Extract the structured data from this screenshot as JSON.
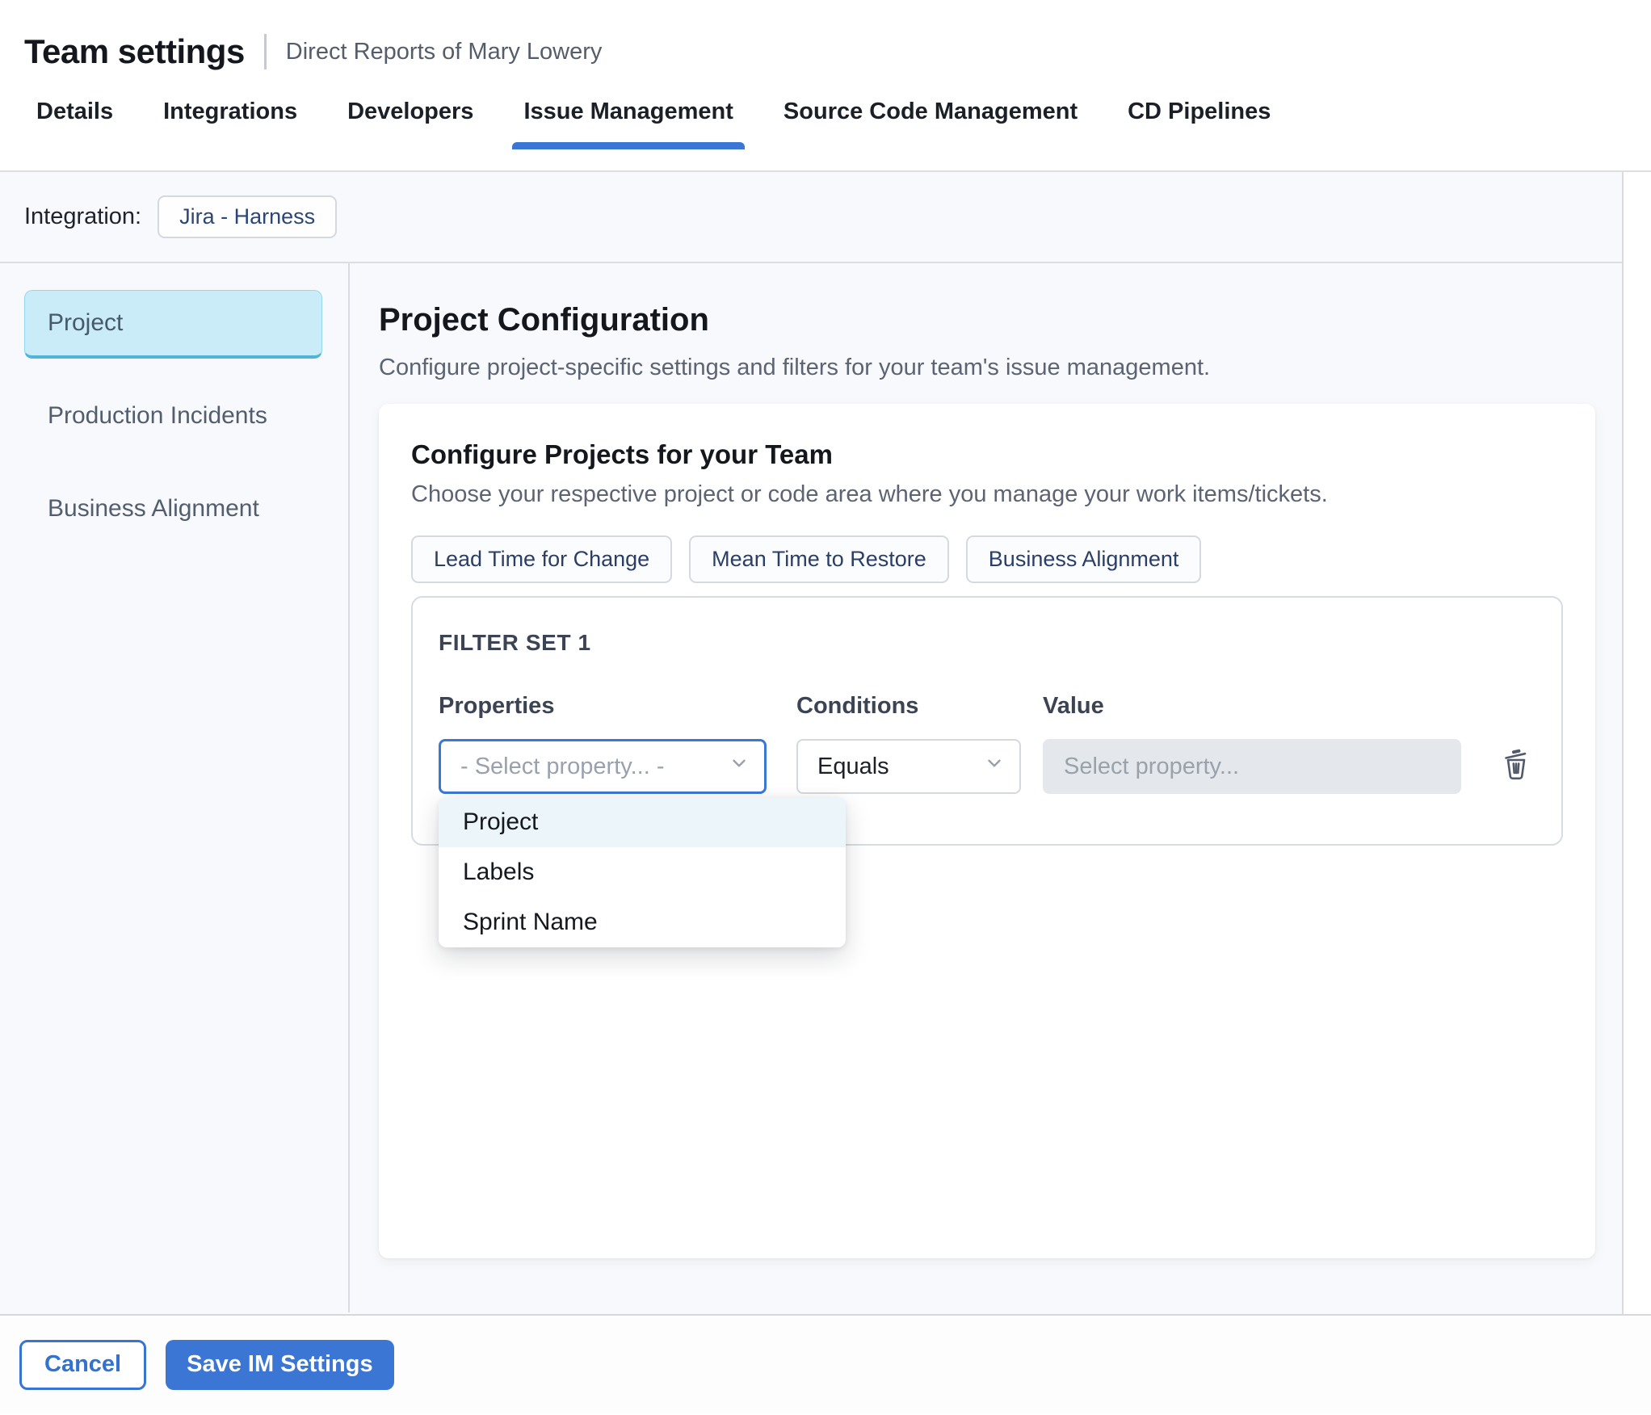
{
  "header": {
    "title": "Team settings",
    "subtitle": "Direct Reports of Mary Lowery"
  },
  "tabs": [
    {
      "label": "Details",
      "active": false
    },
    {
      "label": "Integrations",
      "active": false
    },
    {
      "label": "Developers",
      "active": false
    },
    {
      "label": "Issue Management",
      "active": true
    },
    {
      "label": "Source Code Management",
      "active": false
    },
    {
      "label": "CD Pipelines",
      "active": false
    }
  ],
  "integration": {
    "label": "Integration:",
    "value": "Jira - Harness"
  },
  "sidebar": {
    "items": [
      {
        "label": "Project",
        "active": true
      },
      {
        "label": "Production Incidents",
        "active": false
      },
      {
        "label": "Business Alignment",
        "active": false
      }
    ]
  },
  "main": {
    "title": "Project Configuration",
    "subtitle": "Configure project-specific settings and filters for your team's issue management.",
    "card": {
      "title": "Configure Projects for your Team",
      "subtitle": "Choose your respective project or code area where you manage your work items/tickets.",
      "chips": [
        "Lead Time for Change",
        "Mean Time to Restore",
        "Business Alignment"
      ],
      "filter_set": {
        "title": "FILTER SET 1",
        "columns": {
          "properties": "Properties",
          "conditions": "Conditions",
          "value": "Value"
        },
        "property_placeholder": "- Select property... -",
        "condition_value": "Equals",
        "value_placeholder": "Select property...",
        "options": [
          {
            "label": "Project",
            "highlighted": true
          },
          {
            "label": "Labels",
            "highlighted": false
          },
          {
            "label": "Sprint Name",
            "highlighted": false
          }
        ]
      }
    }
  },
  "footer": {
    "cancel_label": "Cancel",
    "save_label": "Save IM Settings"
  },
  "colors": {
    "accent_blue": "#3b76d4",
    "active_nav_bg": "#c9ecf8",
    "active_nav_border": "#50b4d7",
    "panel_bg": "#f8f9fc",
    "disabled_input_bg": "#e4e8ed",
    "dropdown_highlight": "#ecf6fa",
    "chip_text": "#2a3e68",
    "placeholder_gray": "#99a1ad"
  }
}
